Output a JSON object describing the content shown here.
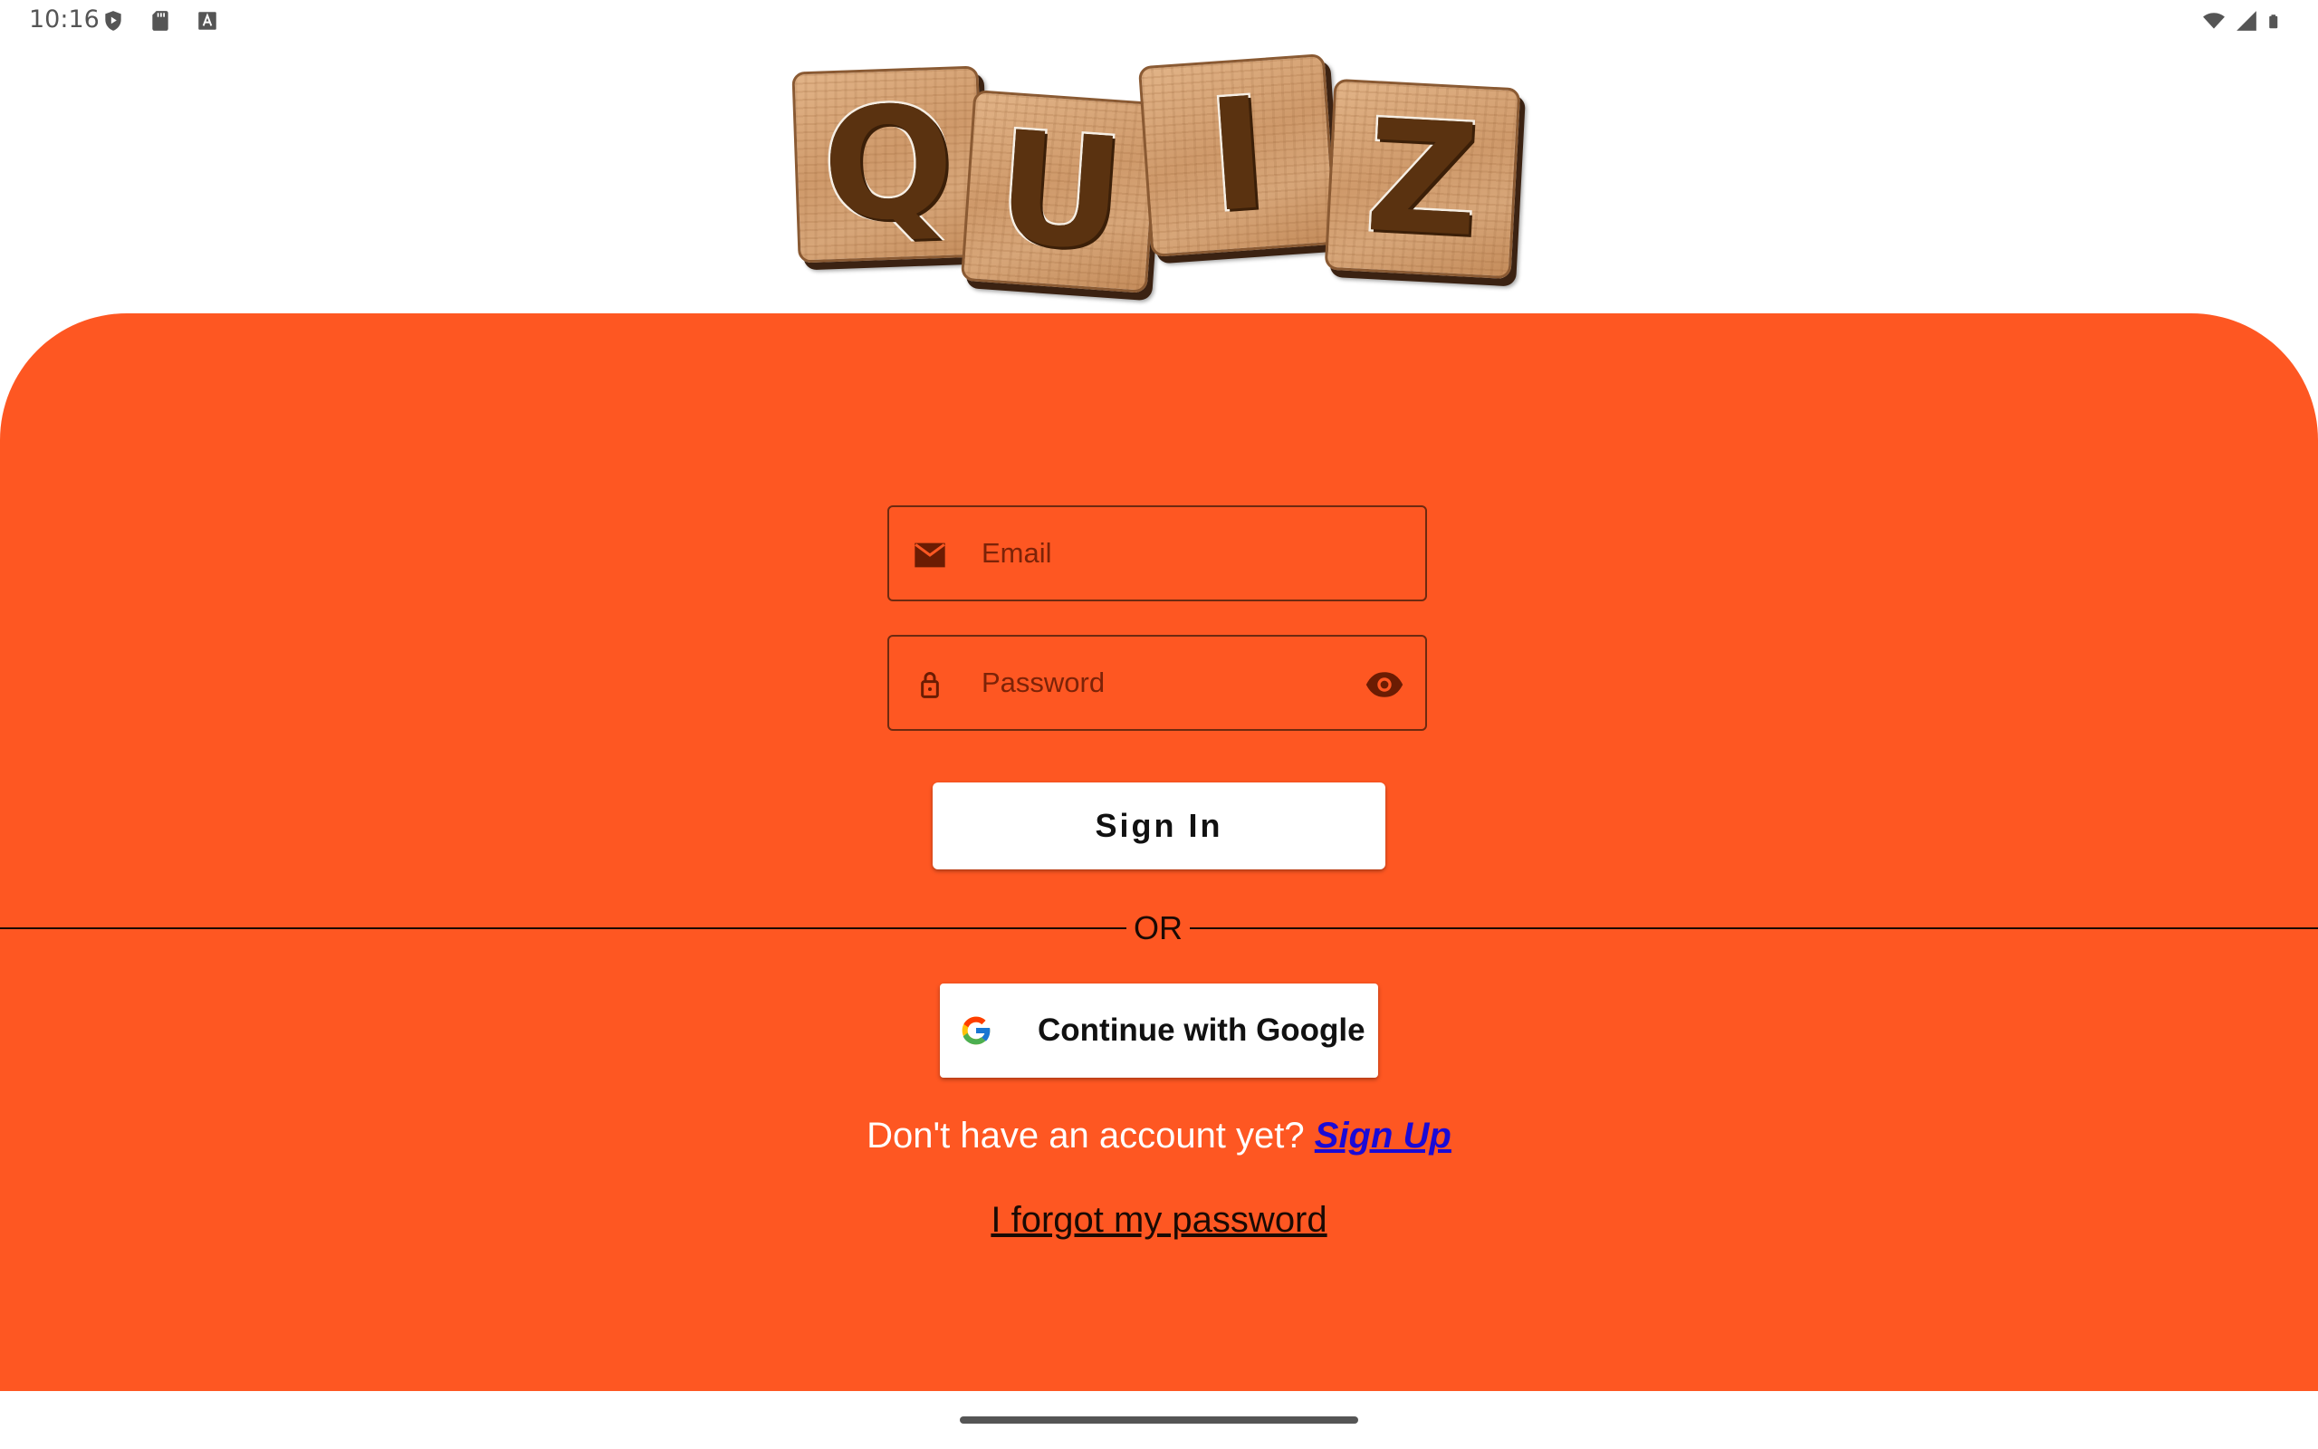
{
  "status_bar": {
    "time": "10:16",
    "left_icons": [
      "play-protect-icon",
      "sd-card-icon",
      "font-a-icon"
    ],
    "right_icons": [
      "wifi-icon",
      "cell-signal-icon",
      "battery-icon"
    ]
  },
  "logo": {
    "letters": [
      "Q",
      "U",
      "I",
      "Z"
    ]
  },
  "login": {
    "email_placeholder": "Email",
    "password_placeholder": "Password",
    "sign_in_label": "Sign In",
    "or_label": "OR",
    "google_label": "Continue with Google",
    "no_account_text": "Don't have an account yet?",
    "sign_up_label": "Sign Up",
    "forgot_label": "I forgot my password"
  },
  "colors": {
    "panel": "#fe5722",
    "field_border": "#6e2a10",
    "field_text": "#7c2308",
    "sign_up_link": "#1a0ad6",
    "button_bg": "#ffffff"
  }
}
